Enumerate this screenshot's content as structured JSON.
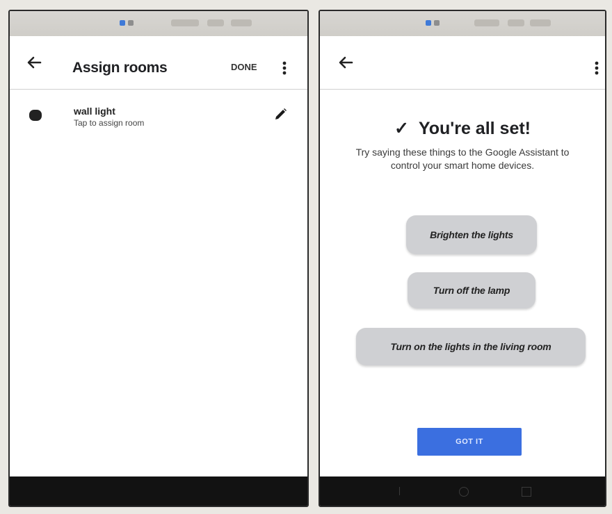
{
  "assign_screen": {
    "title": "Assign rooms",
    "done_label": "DONE",
    "device": {
      "name": "wall light",
      "hint": "Tap to assign room"
    }
  },
  "setup_screen": {
    "title": "You're all set!",
    "check_glyph": "✓",
    "subtitle": "Try saying these things to the Google Assistant to control your smart home devices.",
    "suggestions": [
      "Brighten the lights",
      "Turn off the lamp",
      "Turn on the lights in the living room"
    ],
    "got_it_label": "GOT IT"
  },
  "colors": {
    "accent_button": "#3b6fe0",
    "chip_background": "#cfd0d3",
    "status_icon_blue": "#3f7ad8",
    "nav_bar": "#121212"
  },
  "icons": [
    "back-arrow-icon",
    "more-vert-icon",
    "pencil-icon",
    "device-icon",
    "checkmark-icon"
  ]
}
